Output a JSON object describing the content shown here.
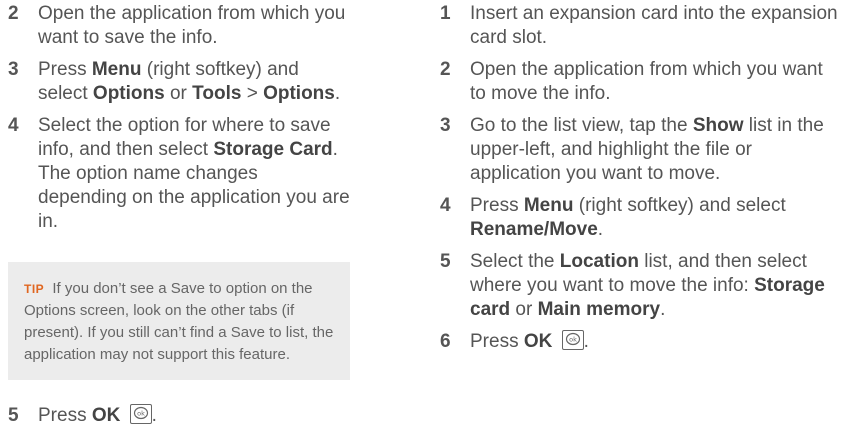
{
  "left": {
    "steps": [
      {
        "num": "2",
        "text": "Open the application from which you want to save the info."
      },
      {
        "num": "3",
        "a": "Press ",
        "b1": "Menu",
        "c": " (right softkey) and select ",
        "b2": "Options",
        "d": " or ",
        "b3": "Tools",
        "e": " > ",
        "b4": "Options",
        "f": "."
      },
      {
        "num": "4",
        "a": "Select the option for where to save info, and then select ",
        "b1": "Storage Card",
        "c": ". The option name changes depending on the application you are in."
      },
      {
        "num": "5",
        "a": "Press ",
        "b1": "OK",
        "c": "."
      }
    ],
    "tip": {
      "label": "TIP",
      "text": "If you don’t see a Save to option on the Options screen, look on the other tabs (if present). If you still can’t find a Save to list, the application may not support this feature."
    }
  },
  "right": {
    "steps": [
      {
        "num": "1",
        "text": "Insert an expansion card into the expansion card slot."
      },
      {
        "num": "2",
        "text": "Open the application from which you want to move the info."
      },
      {
        "num": "3",
        "a": "Go to the list view, tap the ",
        "b1": "Show",
        "c": " list in the upper-left, and highlight the file or application you want to move."
      },
      {
        "num": "4",
        "a": "Press ",
        "b1": "Menu",
        "c": " (right softkey) and select ",
        "b2": "Rename/Move",
        "d": "."
      },
      {
        "num": "5",
        "a": "Select the ",
        "b1": "Location",
        "c": " list, and then select where you want to move the info: ",
        "b2": "Storage card",
        "d": " or ",
        "b3": "Main memory",
        "e": "."
      },
      {
        "num": "6",
        "a": "Press ",
        "b1": "OK",
        "c": "."
      }
    ]
  },
  "icons": {
    "ok_key": "ok-key-icon",
    "ok_key_text": "ok"
  }
}
